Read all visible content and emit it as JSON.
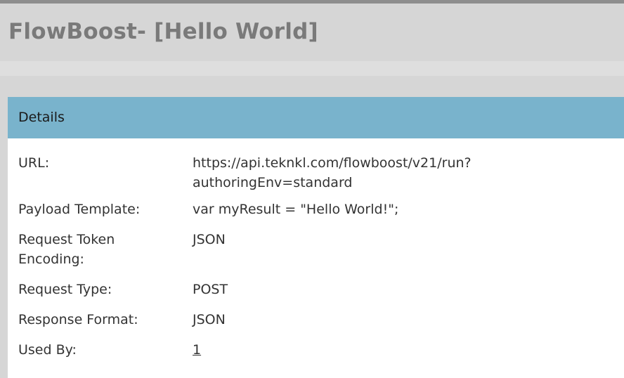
{
  "page": {
    "title": "FlowBoost- [Hello World]"
  },
  "details": {
    "header": "Details",
    "rows": [
      {
        "label": "URL:",
        "value_line1": "https://api.teknkl.com/flowboost/v21/run?",
        "value_line2": "authoringEnv=standard"
      },
      {
        "label": "Payload Template:",
        "value": "var myResult = \"Hello World!\";"
      },
      {
        "label_line1": "Request Token",
        "label_line2": "Encoding:",
        "value": "JSON"
      },
      {
        "label": "Request Type:",
        "value": "POST"
      },
      {
        "label": "Response Format:",
        "value": "JSON"
      },
      {
        "label": "Used By:",
        "value": "1"
      }
    ]
  },
  "colors": {
    "panel_header": "#79b3cc",
    "page_background": "#d6d6d6",
    "title_text": "#7a7a7a"
  }
}
